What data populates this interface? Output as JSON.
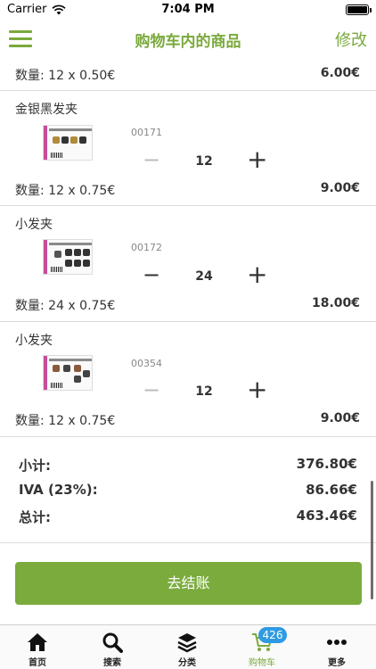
{
  "status": {
    "carrier": "Carrier",
    "time": "7:04 PM"
  },
  "nav": {
    "title": "购物车内的商品",
    "edit_label": "修改"
  },
  "first_row": {
    "qty_text": "数量: 12 x 0.50€",
    "amount": "6.00€"
  },
  "items": [
    {
      "name": "金银黑发夹",
      "code": "00171",
      "quantity": "12",
      "qty_text": "数量: 12 x 0.75€",
      "amount": "9.00€",
      "minus_enabled": false
    },
    {
      "name": "小发夹",
      "code": "00172",
      "quantity": "24",
      "qty_text": "数量: 24 x 0.75€",
      "amount": "18.00€",
      "minus_enabled": true
    },
    {
      "name": "小发夹",
      "code": "00354",
      "quantity": "12",
      "qty_text": "数量: 12 x 0.75€",
      "amount": "9.00€",
      "minus_enabled": false
    }
  ],
  "summary": {
    "subtotal_label": "小计:",
    "subtotal_value": "376.80€",
    "tax_label": "IVA (23%):",
    "tax_value": "86.66€",
    "total_label": "总计:",
    "total_value": "463.46€"
  },
  "checkout_label": "去结账",
  "tabs": [
    {
      "label": "首页",
      "icon": "home-icon"
    },
    {
      "label": "搜索",
      "icon": "search-icon"
    },
    {
      "label": "分类",
      "icon": "layers-icon"
    },
    {
      "label": "购物车",
      "icon": "cart-icon",
      "badge": "426",
      "active": true
    },
    {
      "label": "更多",
      "icon": "more-icon"
    }
  ],
  "colors": {
    "accent": "#7aab3c",
    "badge": "#2f9be2"
  }
}
